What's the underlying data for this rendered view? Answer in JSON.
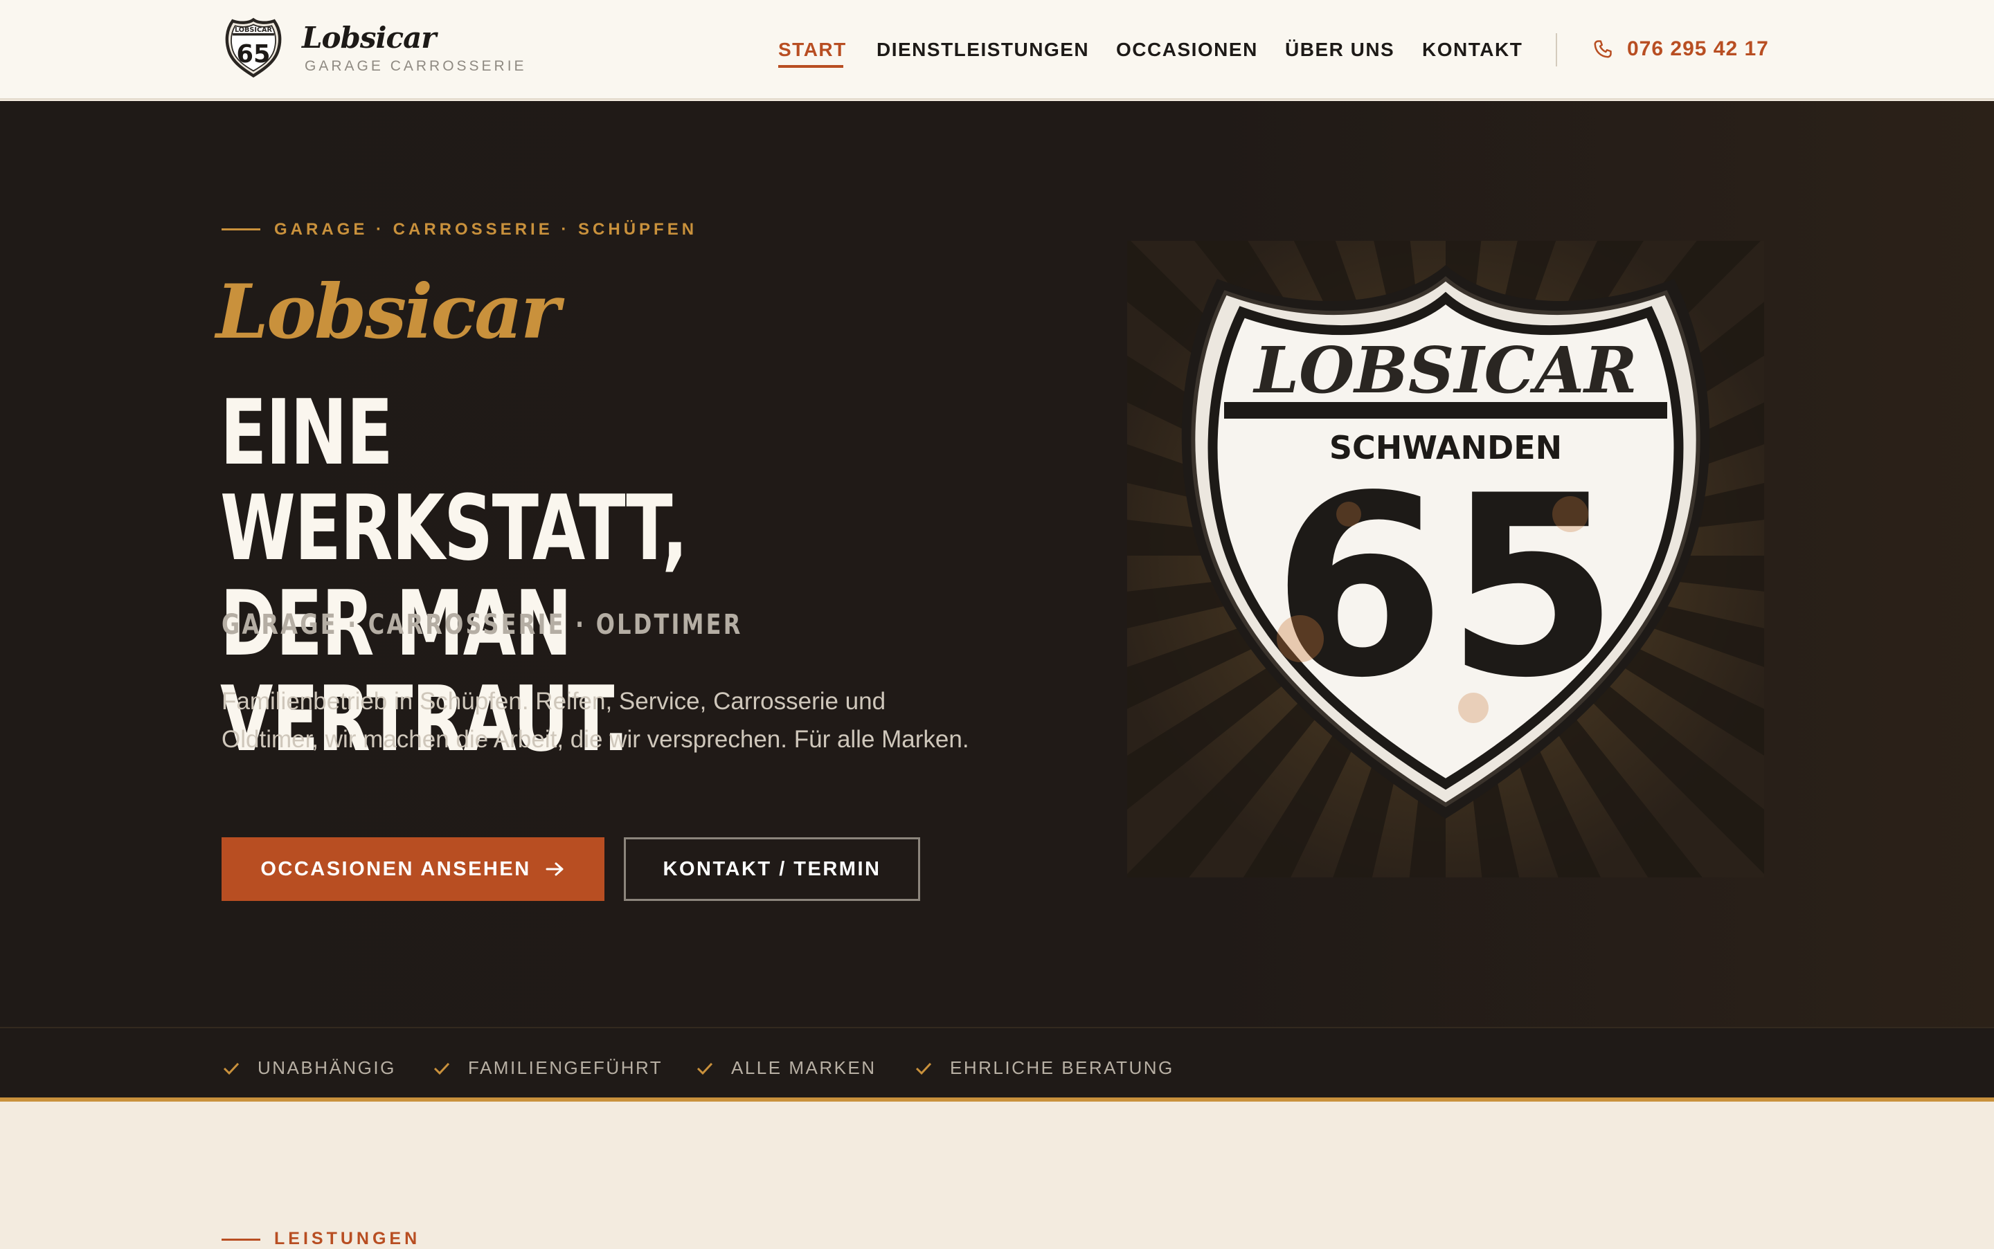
{
  "header": {
    "brand": "Lobsicar",
    "brand_sub": "GARAGE CARROSSERIE",
    "logo_badge_text": "65",
    "logo_badge_small": "LOBSICAR",
    "nav": [
      {
        "label": "START",
        "active": true
      },
      {
        "label": "DIENSTLEISTUNGEN",
        "active": false
      },
      {
        "label": "OCCASIONEN",
        "active": false
      },
      {
        "label": "ÜBER UNS",
        "active": false
      },
      {
        "label": "KONTAKT",
        "active": false
      }
    ],
    "phone": "076 295 42 17",
    "phone_icon": "phone-icon"
  },
  "hero": {
    "eyebrow": "GARAGE · CARROSSERIE · SCHÜPFEN",
    "script_title": "Lobsicar",
    "headline_line1": "EINE WERKSTATT,",
    "headline_line2": "DER MAN VERTRAUT.",
    "subline": "GARAGE · CARROSSERIE · OLDTIMER",
    "text": "Familienbetrieb in Schüpfen. Reifen, Service, Carrosserie und Oldtimer, wir machen die Arbeit, die wir versprechen. Für alle Marken.",
    "primary_button": "OCCASIONEN ANSEHEN",
    "secondary_button": "KONTAKT / TERMIN",
    "shield": {
      "top_text": "LOBSICAR",
      "middle_text": "SCHWANDEN",
      "number": "65"
    }
  },
  "features": [
    {
      "label": "UNABHÄNGIG",
      "icon": "check-icon"
    },
    {
      "label": "FAMILIENGEFÜHRT",
      "icon": "check-icon"
    },
    {
      "label": "ALLE MARKEN",
      "icon": "check-icon"
    },
    {
      "label": "EHRLICHE BERATUNG",
      "icon": "check-icon"
    }
  ],
  "section": {
    "eyebrow": "LEISTUNGEN"
  },
  "colors": {
    "accent": "#b84e22",
    "gold": "#c9913c",
    "dark": "#1f1a17",
    "cream": "#faf7f0"
  }
}
